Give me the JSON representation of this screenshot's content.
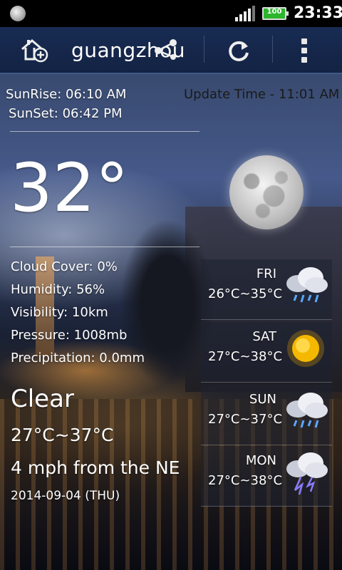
{
  "statusbar": {
    "battery": "100",
    "time": "23:33"
  },
  "actionbar": {
    "city": "guangzhou"
  },
  "sun": {
    "sunrise": "SunRise: 06:10 AM",
    "sunset": "SunSet: 06:42 PM"
  },
  "update_time": "Update Time - 11:01 AM",
  "current": {
    "temperature": "32°",
    "cloud_cover": "Cloud Cover: 0%",
    "humidity": "Humidity: 56%",
    "visibility": "Visibility: 10km",
    "pressure": "Pressure: 1008mb",
    "precipitation": "Precipitation: 0.0mm",
    "condition": "Clear",
    "range": "27°C~37°C",
    "wind": "4 mph from the NE",
    "date": "2014-09-04 (THU)"
  },
  "forecast": [
    {
      "day": "FRI",
      "range": "26°C~35°C",
      "icon": "rain-cloud-icon"
    },
    {
      "day": "SAT",
      "range": "27°C~38°C",
      "icon": "sun-icon"
    },
    {
      "day": "SUN",
      "range": "27°C~37°C",
      "icon": "rain-cloud-icon"
    },
    {
      "day": "MON",
      "range": "27°C~38°C",
      "icon": "thunderstorm-icon"
    }
  ],
  "colors": {
    "actionbar": "#0c1c3c",
    "battery": "#2bb62b",
    "sun": "#f4b800"
  }
}
